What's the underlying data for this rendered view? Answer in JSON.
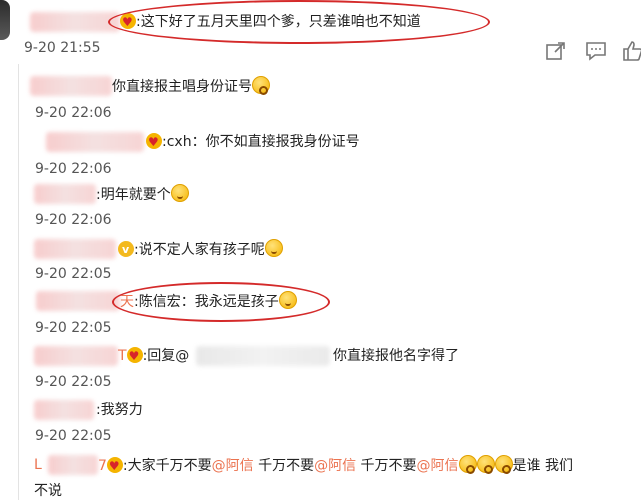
{
  "top": {
    "text": ":这下好了五月天里四个爹，只差谁咱也不知道",
    "time": "9-20 21:55"
  },
  "replies": [
    {
      "text": "你直接报主唱身份证号",
      "time": "9-20 22:06"
    },
    {
      "text": ":cxh：你不如直接报我身份证号",
      "time": "9-20 22:06"
    },
    {
      "text": ":明年就要个",
      "time": "9-20 22:06"
    },
    {
      "text": ":说不定人家有孩子呢",
      "time": "9-20 22:05"
    },
    {
      "prefix": "天",
      "text": ":陈信宏：我永远是孩子",
      "time": "9-20 22:05"
    },
    {
      "prefix": "T",
      "text_a": ":回复@",
      "text_b": "你直接报他名字得了",
      "time": "9-20 22:05"
    },
    {
      "text": ":我努力",
      "time": "9-20 22:05"
    },
    {
      "prefix": "L",
      "suffix": "7",
      "text_a": ":大家千万不要",
      "mention": "@阿信",
      "text_b": " 千万不要",
      "text_c": " 千万不要",
      "text_d": "是谁 我们",
      "text_wrap": "不说",
      "time": "9-20 22:05"
    }
  ],
  "icons": {
    "share": "share-icon",
    "comment": "comment-icon",
    "like": "like-icon"
  },
  "colors": {
    "mention": "#eb7350",
    "highlight_oval": "#d42a2a"
  }
}
